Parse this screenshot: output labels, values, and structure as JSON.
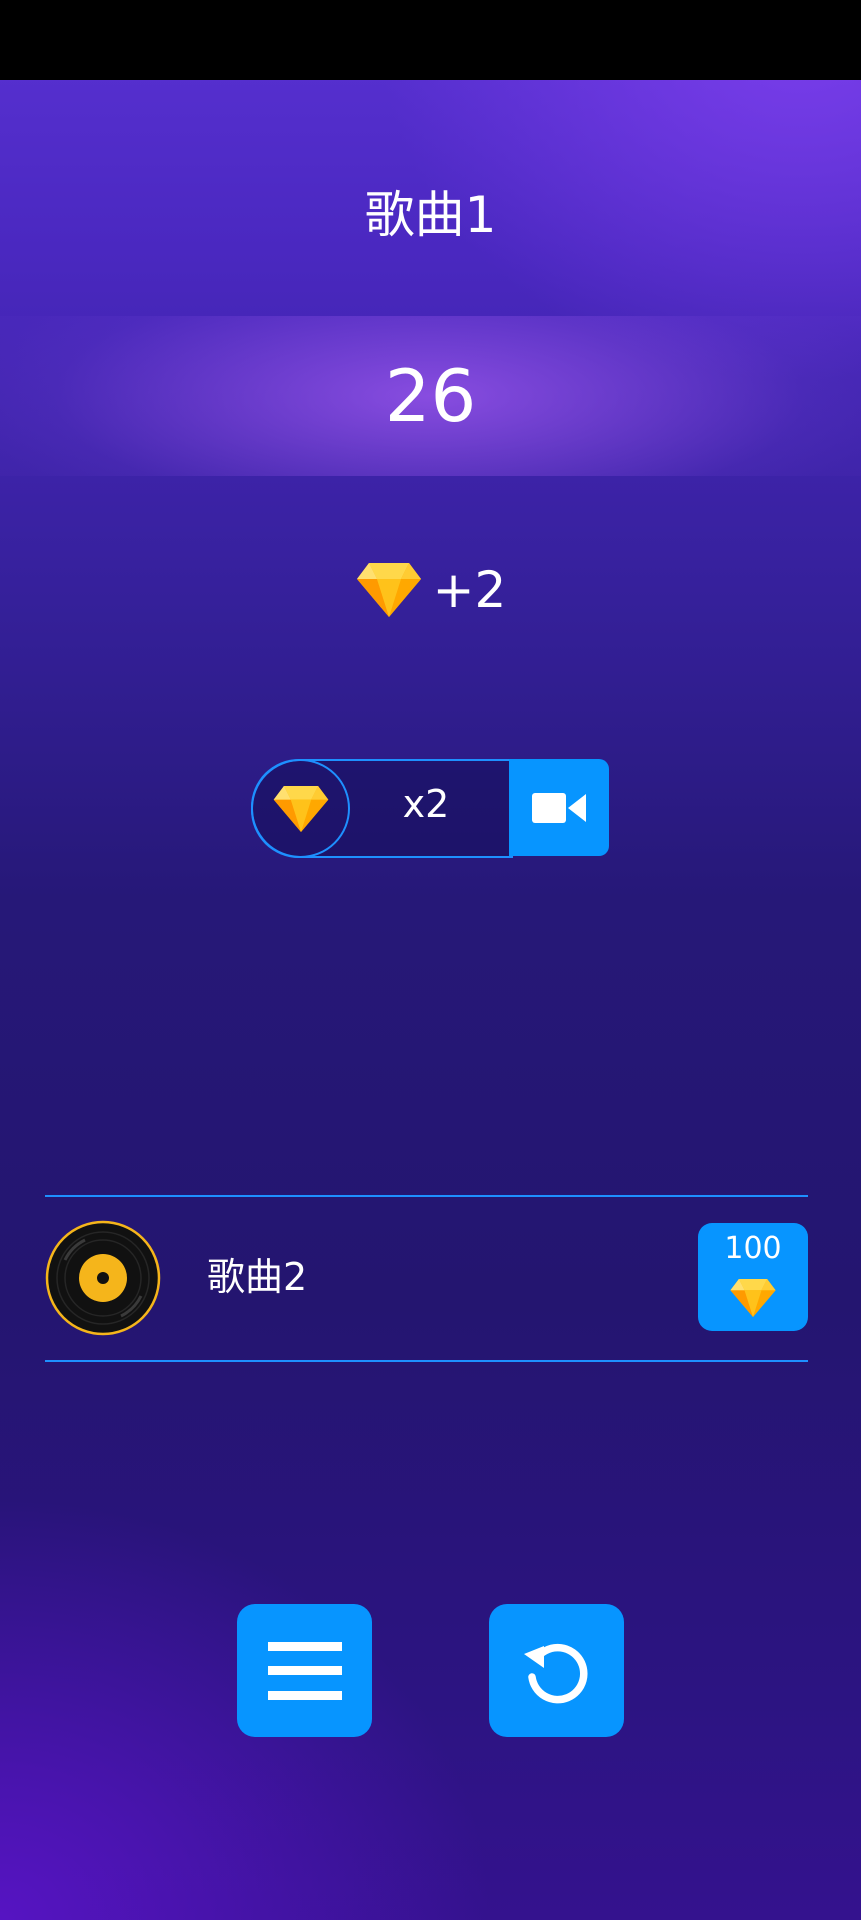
{
  "result": {
    "song_title": "歌曲1",
    "score": "26",
    "reward": "+2"
  },
  "double_reward": {
    "label": "x2",
    "icon": "video-camera-icon"
  },
  "next_song": {
    "title": "歌曲2",
    "price": "100",
    "icon": "vinyl-disc-icon"
  },
  "actions": {
    "menu_icon": "menu-icon",
    "retry_icon": "retry-icon"
  },
  "colors": {
    "accent": "#0795ff",
    "gem": "#ffc21a",
    "disc_label": "#f5b51b"
  }
}
